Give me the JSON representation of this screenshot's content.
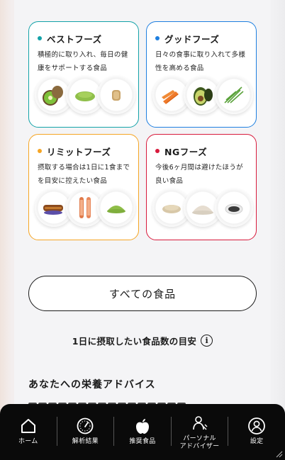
{
  "cards": [
    {
      "title": "ベストフーズ",
      "desc": "積極的に取り入れ、毎日の健康をサポートする食品",
      "color": "#13a2a8",
      "foods": [
        "kiwi-icon",
        "matcha-powder-icon",
        "ginger-icon"
      ]
    },
    {
      "title": "グッドフーズ",
      "desc": "日々の食事に取り入れて多様性を高める食品",
      "color": "#1e7fe0",
      "foods": [
        "carrot-icon",
        "avocado-icon",
        "herb-icon"
      ]
    },
    {
      "title": "リミットフーズ",
      "desc": "摂取する場合は1日に1食までを目安に控えたい食品",
      "color": "#f5a524",
      "foods": [
        "eel-icon",
        "shrimp-icon",
        "green-powder-icon"
      ]
    },
    {
      "title": "NGフーズ",
      "desc": "今後6ヶ月間は避けたほうが良い食品",
      "color": "#d81a3c",
      "foods": [
        "grain-icon",
        "flour-icon",
        "sesame-icon"
      ]
    }
  ],
  "all_foods_button": "すべての食品",
  "guide_text": "1日に摂取したい食品数の目安",
  "advice": {
    "title": "あなたへの栄養アドバイス"
  },
  "nav": [
    {
      "label": "ホーム",
      "icon": "home-icon"
    },
    {
      "label": "解析結果",
      "icon": "gauge-icon"
    },
    {
      "label": "推奨食品",
      "icon": "apple-icon"
    },
    {
      "label": "パーソナル\nアドバイザー",
      "icon": "advisor-icon"
    },
    {
      "label": "設定",
      "icon": "user-icon"
    }
  ]
}
